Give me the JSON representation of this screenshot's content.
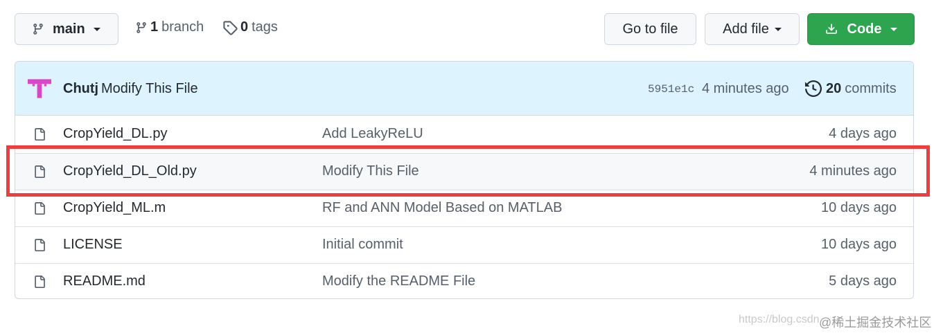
{
  "toolbar": {
    "branch_select_label": "main",
    "branch_count": "1",
    "branch_word": "branch",
    "tag_count": "0",
    "tag_word": "tags",
    "go_to_file_label": "Go to file",
    "add_file_label": "Add file",
    "code_label": "Code"
  },
  "latest_commit": {
    "author": "Chutj",
    "message": "Modify This File",
    "sha": "5951e1c",
    "age": "4 minutes ago",
    "commit_count": "20",
    "commits_word": "commits"
  },
  "files": [
    {
      "name": "CropYield_DL.py",
      "message": "Add LeakyReLU",
      "age": "4 days ago"
    },
    {
      "name": "CropYield_DL_Old.py",
      "message": "Modify This File",
      "age": "4 minutes ago"
    },
    {
      "name": "CropYield_ML.m",
      "message": "RF and ANN Model Based on MATLAB",
      "age": "10 days ago"
    },
    {
      "name": "LICENSE",
      "message": "Initial commit",
      "age": "10 days ago"
    },
    {
      "name": "README.md",
      "message": "Modify the README File",
      "age": "5 days ago"
    }
  ],
  "watermark": {
    "url_text": "https://blog.csdn",
    "site_text": "@稀土掘金技术社区"
  },
  "colors": {
    "code_button": "#2da44e",
    "commit_bar": "#ddf4ff",
    "highlight_border": "#ef3c3c",
    "avatar": "#d946c8"
  },
  "icons": [
    "git-branch-icon",
    "tag-icon",
    "download-icon",
    "history-icon",
    "file-icon"
  ]
}
